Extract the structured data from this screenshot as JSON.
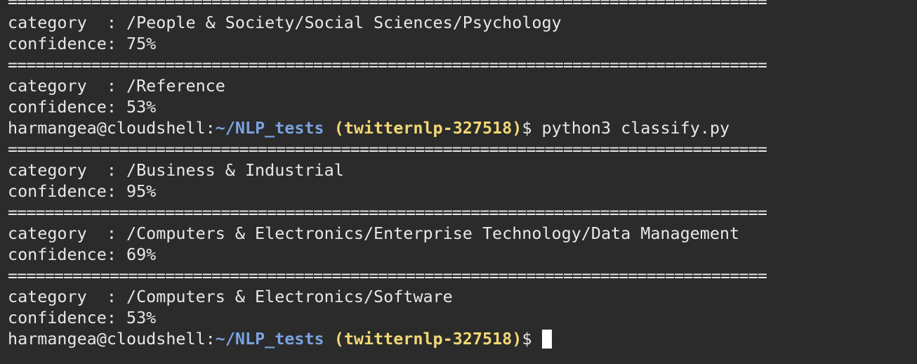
{
  "prompt": {
    "user_host": "harmangea@cloudshell:",
    "path": "~/NLP_tests",
    "project": "(twitternlp-327518)",
    "symbol": "$"
  },
  "separator": "==================================================================================",
  "lines": [
    {
      "type": "sep"
    },
    {
      "type": "text",
      "text": "category  : /People & Society/Social Sciences/Psychology"
    },
    {
      "type": "text",
      "text": "confidence: 75%"
    },
    {
      "type": "sep"
    },
    {
      "type": "text",
      "text": "category  : /Reference"
    },
    {
      "type": "text",
      "text": "confidence: 53%"
    },
    {
      "type": "prompt",
      "command": " python3 classify.py"
    },
    {
      "type": "sep"
    },
    {
      "type": "text",
      "text": "category  : /Business & Industrial"
    },
    {
      "type": "text",
      "text": "confidence: 95%"
    },
    {
      "type": "sep"
    },
    {
      "type": "text",
      "text": "category  : /Computers & Electronics/Enterprise Technology/Data Management"
    },
    {
      "type": "text",
      "text": "confidence: 69%"
    },
    {
      "type": "sep"
    },
    {
      "type": "text",
      "text": "category  : /Computers & Electronics/Software"
    },
    {
      "type": "text",
      "text": "confidence: 53%"
    },
    {
      "type": "prompt",
      "command": " ",
      "cursor": true
    }
  ]
}
